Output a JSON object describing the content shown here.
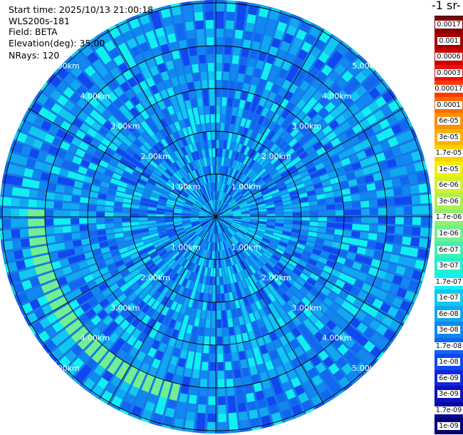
{
  "info": {
    "start_time": "Start time: 2025/10/13 21:00:18",
    "instrument": "WLS200s-181",
    "field": "Field: BETA",
    "elevation": "Elevation(deg): 35.00",
    "nrays": "NRays: 120"
  },
  "unit_title": "-1 sr-",
  "colorbar": {
    "entries": [
      {
        "label": "0.0017",
        "color": "#8a0000"
      },
      {
        "label": "0.001",
        "color": "#a80000"
      },
      {
        "label": "0.0006",
        "color": "#cc0000"
      },
      {
        "label": "0.0003",
        "color": "#ee1010"
      },
      {
        "label": "0.00017",
        "color": "#ff3a00"
      },
      {
        "label": "0.0001",
        "color": "#ff6a00"
      },
      {
        "label": "6e-05",
        "color": "#ff9000"
      },
      {
        "label": "3e-05",
        "color": "#ffb000"
      },
      {
        "label": "1.7e-05",
        "color": "#ffd000"
      },
      {
        "label": "1e-05",
        "color": "#f0f000"
      },
      {
        "label": "6e-06",
        "color": "#d0f030"
      },
      {
        "label": "3e-06",
        "color": "#b0f050"
      },
      {
        "label": "1.7e-06",
        "color": "#90f070"
      },
      {
        "label": "1e-06",
        "color": "#70f090"
      },
      {
        "label": "6e-07",
        "color": "#40f0b0"
      },
      {
        "label": "3e-07",
        "color": "#20f0d0"
      },
      {
        "label": "1.7e-07",
        "color": "#10f0f0"
      },
      {
        "label": "1e-07",
        "color": "#10c8f0"
      },
      {
        "label": "6e-08",
        "color": "#10a8f0"
      },
      {
        "label": "3e-08",
        "color": "#1088f0"
      },
      {
        "label": "1.7e-08",
        "color": "#1068f0"
      },
      {
        "label": "1e-08",
        "color": "#1048f0"
      },
      {
        "label": "6e-09",
        "color": "#1028e0"
      },
      {
        "label": "3e-09",
        "color": "#1010c0"
      },
      {
        "label": "1.7e-09",
        "color": "#0808a0"
      },
      {
        "label": "1e-09",
        "color": "#000070"
      }
    ]
  },
  "ppi": {
    "nrays": 120,
    "rings_km": [
      1,
      2,
      3,
      4,
      5
    ],
    "ring_labels": [
      "1.00km",
      "2.00km",
      "3.00km",
      "4.00km",
      "5.00km"
    ],
    "spokes_deg": [
      0,
      30,
      60,
      90,
      120,
      150,
      180,
      210,
      240,
      270,
      300,
      330
    ],
    "band_km": [
      5.7,
      6.0
    ],
    "band_color": "#70f090",
    "palette": [
      "#10a8f0",
      "#1088f0",
      "#1068f0",
      "#10c8f0",
      "#10f0f0",
      "#1048f0"
    ]
  }
}
